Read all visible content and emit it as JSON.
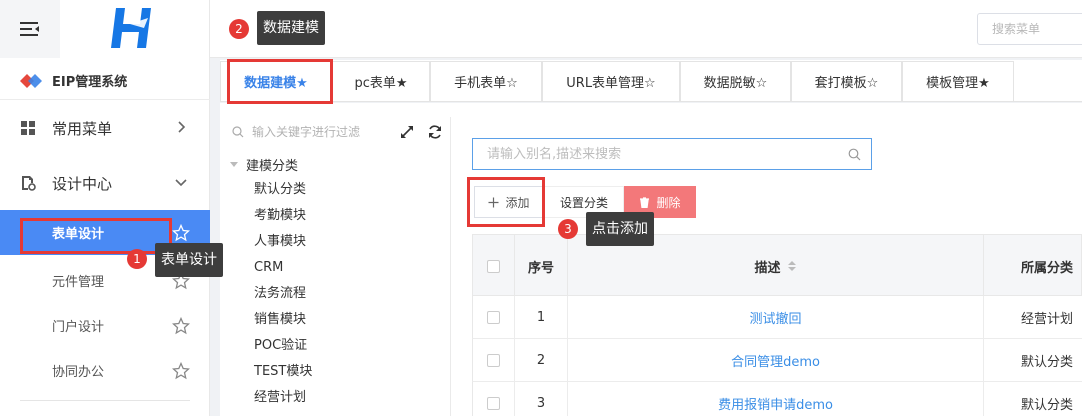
{
  "sidebar": {
    "system_title": "EIP管理系统",
    "menus": [
      {
        "label": "常用菜单",
        "icon": "grid-icon",
        "expanded": false
      },
      {
        "label": "设计中心",
        "icon": "doc-settings-icon",
        "expanded": true
      }
    ],
    "sub_items": [
      {
        "label": "表单设计",
        "active": true
      },
      {
        "label": "元件管理",
        "active": false
      },
      {
        "label": "门户设计",
        "active": false
      },
      {
        "label": "协同办公",
        "active": false
      }
    ]
  },
  "header": {
    "search_placeholder": "搜索菜单"
  },
  "tabs": [
    {
      "label": "数据建模★",
      "active": true
    },
    {
      "label": "pc表单★",
      "active": false
    },
    {
      "label": "手机表单☆",
      "active": false
    },
    {
      "label": "URL表单管理☆",
      "active": false
    },
    {
      "label": "数据脱敏☆",
      "active": false
    },
    {
      "label": "套打模板☆",
      "active": false
    },
    {
      "label": "模板管理★",
      "active": false
    }
  ],
  "tree": {
    "filter_placeholder": "输入关键字进行过滤",
    "root": "建模分类",
    "nodes": [
      "默认分类",
      "考勤模块",
      "人事模块",
      "CRM",
      "法务流程",
      "销售模块",
      "POC验证",
      "TEST模块",
      "经营计划"
    ]
  },
  "list": {
    "search_placeholder": "请输入别名,描述来搜索",
    "buttons": {
      "add": "添加",
      "set_category": "设置分类",
      "delete": "删除"
    },
    "columns": {
      "index": "序号",
      "description": "描述",
      "category": "所属分类"
    },
    "rows": [
      {
        "index": "1",
        "description": "测试撤回",
        "category": "经营计划"
      },
      {
        "index": "2",
        "description": "合同管理demo",
        "category": "默认分类"
      },
      {
        "index": "3",
        "description": "费用报销申请demo",
        "category": "默认分类"
      }
    ]
  },
  "annotations": [
    {
      "number": "1",
      "text": "表单设计"
    },
    {
      "number": "2",
      "text": "数据建模"
    },
    {
      "number": "3",
      "text": "点击添加"
    }
  ],
  "colors": {
    "primary": "#4a8af4",
    "link": "#3a8ee6",
    "danger": "#f3787a",
    "highlight": "#e53935"
  }
}
